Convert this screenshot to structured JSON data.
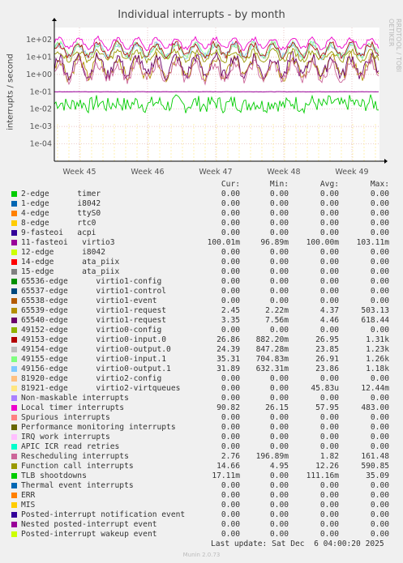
{
  "chart_data": {
    "type": "line",
    "title": "Individual interrupts - by month",
    "ylabel": "interrupts / second",
    "yscale": "log",
    "ylim": [
      1e-05,
      500
    ],
    "y_ticks": [
      "1e-04",
      "1e-03",
      "1e-02",
      "1e-01",
      "1e+00",
      "1e+01",
      "1e+02"
    ],
    "x_ticks": [
      "Week 45",
      "Week 46",
      "Week 47",
      "Week 48",
      "Week 49"
    ],
    "grid": true,
    "legend_headers": [
      "Cur:",
      "Min:",
      "Avg:",
      "Max:"
    ],
    "series": [
      {
        "name": "2-edge      timer",
        "color": "#00cc00",
        "cur": "0.00",
        "min": "0.00",
        "avg": "0.00",
        "max": "0.00"
      },
      {
        "name": "1-edge      i8042",
        "color": "#0066b3",
        "cur": "0.00",
        "min": "0.00",
        "avg": "0.00",
        "max": "0.00"
      },
      {
        "name": "4-edge      ttyS0",
        "color": "#ff8000",
        "cur": "0.00",
        "min": "0.00",
        "avg": "0.00",
        "max": "0.00"
      },
      {
        "name": "8-edge      rtc0",
        "color": "#ffcc00",
        "cur": "0.00",
        "min": "0.00",
        "avg": "0.00",
        "max": "0.00"
      },
      {
        "name": "9-fasteoi   acpi",
        "color": "#330099",
        "cur": "0.00",
        "min": "0.00",
        "avg": "0.00",
        "max": "0.00"
      },
      {
        "name": "11-fasteoi   virtio3",
        "color": "#990099",
        "cur": "100.01m",
        "min": "96.89m",
        "avg": "100.00m",
        "max": "103.11m"
      },
      {
        "name": "12-edge      i8042",
        "color": "#ccff00",
        "cur": "0.00",
        "min": "0.00",
        "avg": "0.00",
        "max": "0.00"
      },
      {
        "name": "14-edge      ata_piix",
        "color": "#ff0000",
        "cur": "0.00",
        "min": "0.00",
        "avg": "0.00",
        "max": "0.00"
      },
      {
        "name": "15-edge      ata_piix",
        "color": "#808080",
        "cur": "0.00",
        "min": "0.00",
        "avg": "0.00",
        "max": "0.00"
      },
      {
        "name": "65536-edge      virtio1-config",
        "color": "#008f00",
        "cur": "0.00",
        "min": "0.00",
        "avg": "0.00",
        "max": "0.00"
      },
      {
        "name": "65537-edge      virtio1-control",
        "color": "#00487d",
        "cur": "0.00",
        "min": "0.00",
        "avg": "0.00",
        "max": "0.00"
      },
      {
        "name": "65538-edge      virtio1-event",
        "color": "#b35a00",
        "cur": "0.00",
        "min": "0.00",
        "avg": "0.00",
        "max": "0.00"
      },
      {
        "name": "65539-edge      virtio1-request",
        "color": "#b38f00",
        "cur": "2.45",
        "min": "2.22m",
        "avg": "4.37",
        "max": "503.13"
      },
      {
        "name": "65540-edge      virtio1-request",
        "color": "#6b006b",
        "cur": "3.35",
        "min": "7.56m",
        "avg": "4.46",
        "max": "618.44"
      },
      {
        "name": "49152-edge      virtio0-config",
        "color": "#8fb300",
        "cur": "0.00",
        "min": "0.00",
        "avg": "0.00",
        "max": "0.00"
      },
      {
        "name": "49153-edge      virtio0-input.0",
        "color": "#b30000",
        "cur": "26.86",
        "min": "882.20m",
        "avg": "26.95",
        "max": "1.31k"
      },
      {
        "name": "49154-edge      virtio0-output.0",
        "color": "#bebebe",
        "cur": "24.39",
        "min": "847.28m",
        "avg": "23.85",
        "max": "1.23k"
      },
      {
        "name": "49155-edge      virtio0-input.1",
        "color": "#80ff80",
        "cur": "35.31",
        "min": "704.83m",
        "avg": "26.91",
        "max": "1.26k"
      },
      {
        "name": "49156-edge      virtio0-output.1",
        "color": "#80c9ff",
        "cur": "31.89",
        "min": "632.31m",
        "avg": "23.86",
        "max": "1.18k"
      },
      {
        "name": "81920-edge      virtio2-config",
        "color": "#ffc080",
        "cur": "0.00",
        "min": "0.00",
        "avg": "0.00",
        "max": "0.00"
      },
      {
        "name": "81921-edge      virtio2-virtqueues",
        "color": "#ffe680",
        "cur": "0.00",
        "min": "0.00",
        "avg": "45.83u",
        "max": "12.44m"
      },
      {
        "name": "Non-maskable interrupts",
        "color": "#aa80ff",
        "cur": "0.00",
        "min": "0.00",
        "avg": "0.00",
        "max": "0.00"
      },
      {
        "name": "Local timer interrupts",
        "color": "#ee00cc",
        "cur": "90.82",
        "min": "26.15",
        "avg": "57.95",
        "max": "483.00"
      },
      {
        "name": "Spurious interrupts",
        "color": "#ff8080",
        "cur": "0.00",
        "min": "0.00",
        "avg": "0.00",
        "max": "0.00"
      },
      {
        "name": "Performance monitoring interrupts",
        "color": "#666600",
        "cur": "0.00",
        "min": "0.00",
        "avg": "0.00",
        "max": "0.00"
      },
      {
        "name": "IRQ work interrupts",
        "color": "#ffbfff",
        "cur": "0.00",
        "min": "0.00",
        "avg": "0.00",
        "max": "0.00"
      },
      {
        "name": "APIC ICR read retries",
        "color": "#00ffcc",
        "cur": "0.00",
        "min": "0.00",
        "avg": "0.00",
        "max": "0.00"
      },
      {
        "name": "Rescheduling interrupts",
        "color": "#cc6699",
        "cur": "2.76",
        "min": "196.89m",
        "avg": "1.82",
        "max": "161.48"
      },
      {
        "name": "Function call interrupts",
        "color": "#999900",
        "cur": "14.66",
        "min": "4.95",
        "avg": "12.26",
        "max": "590.85"
      },
      {
        "name": "TLB shootdowns",
        "color": "#00cc00",
        "cur": "17.11m",
        "min": "0.00",
        "avg": "111.16m",
        "max": "35.09"
      },
      {
        "name": "Thermal event interrupts",
        "color": "#0066b3",
        "cur": "0.00",
        "min": "0.00",
        "avg": "0.00",
        "max": "0.00"
      },
      {
        "name": "ERR",
        "color": "#ff8000",
        "cur": "0.00",
        "min": "0.00",
        "avg": "0.00",
        "max": "0.00"
      },
      {
        "name": "MIS",
        "color": "#ffcc00",
        "cur": "0.00",
        "min": "0.00",
        "avg": "0.00",
        "max": "0.00"
      },
      {
        "name": "Posted-interrupt notification event",
        "color": "#330099",
        "cur": "0.00",
        "min": "0.00",
        "avg": "0.00",
        "max": "0.00"
      },
      {
        "name": "Nested posted-interrupt event",
        "color": "#990099",
        "cur": "0.00",
        "min": "0.00",
        "avg": "0.00",
        "max": "0.00"
      },
      {
        "name": "Posted-interrupt wakeup event",
        "color": "#ccff00",
        "cur": "0.00",
        "min": "0.00",
        "avg": "0.00",
        "max": "0.00"
      }
    ]
  },
  "side_label": "RRDTOOL / TOBI OETIKER",
  "last_update": "Last update: Sat Dec  6 04:00:20 2025",
  "footer": "Munin 2.0.73"
}
